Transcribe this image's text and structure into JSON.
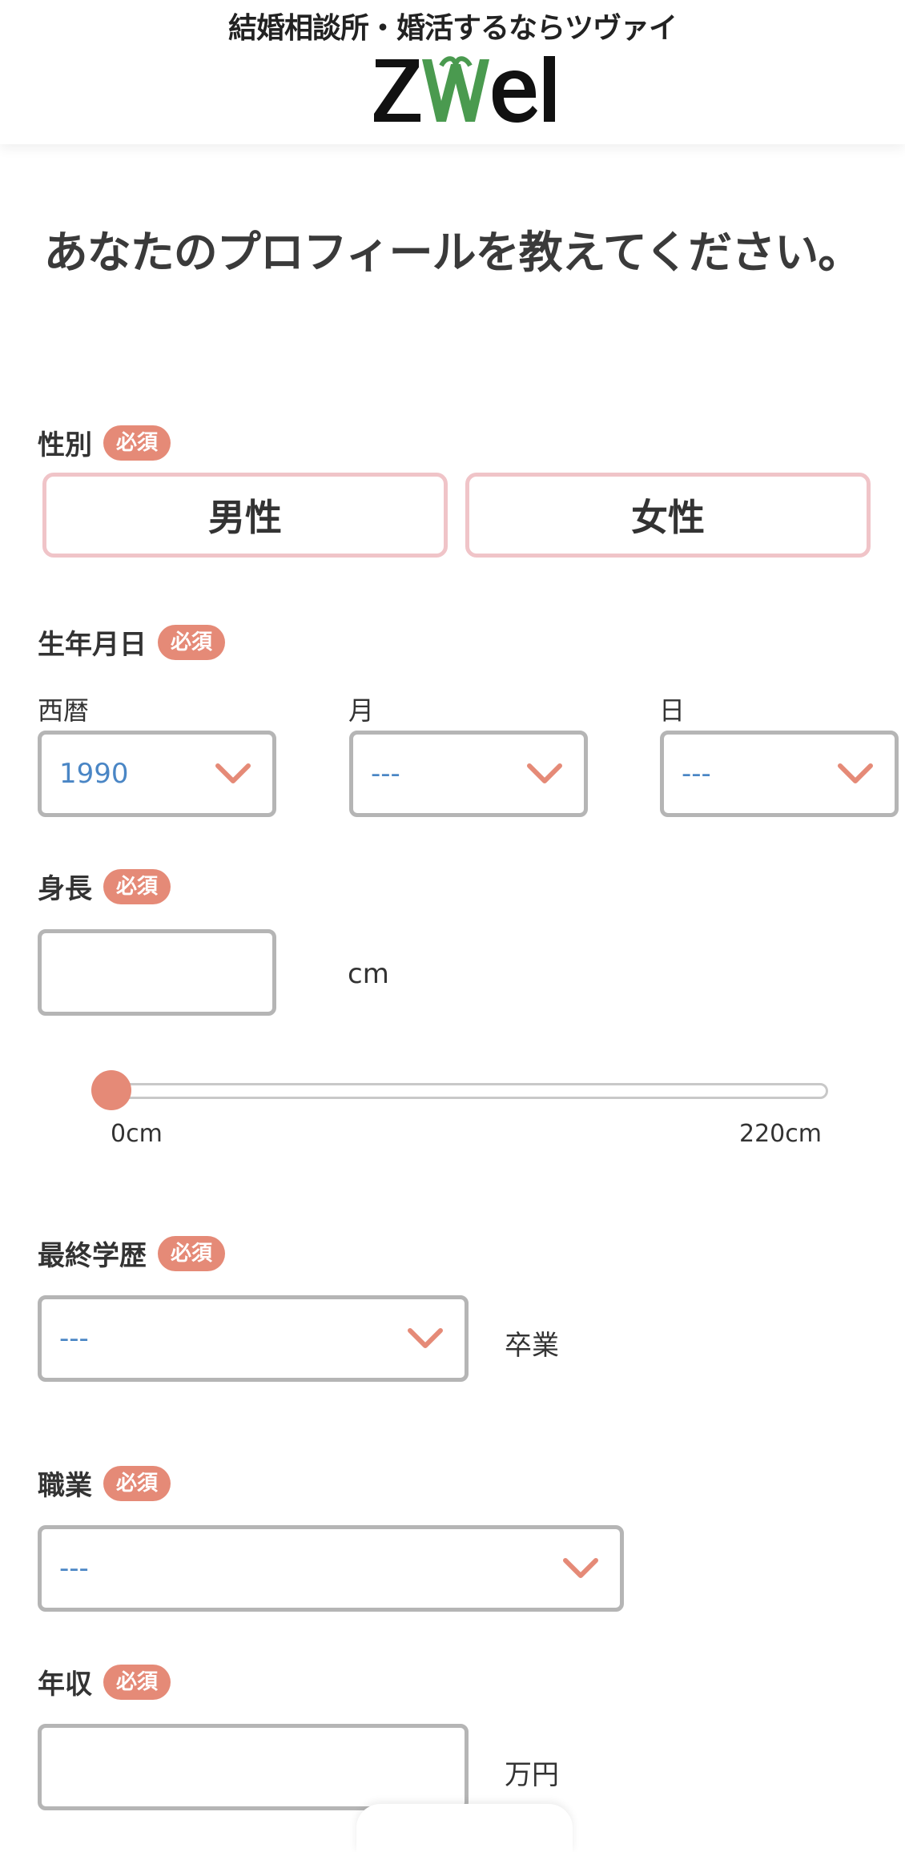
{
  "header": {
    "tagline": "結婚相談所・婚活するならツヴァイ",
    "logo_text": "ZWEI",
    "brand_color": "#4a9a4f"
  },
  "page_title": "あなたのプロフィールを教えてください。",
  "required_badge": "必須",
  "gender": {
    "label": "性別",
    "options": [
      "男性",
      "女性"
    ]
  },
  "birthdate": {
    "label": "生年月日",
    "year_label": "西暦",
    "year_value": "1990",
    "month_label": "月",
    "month_value": "---",
    "day_label": "日",
    "day_value": "---"
  },
  "height": {
    "label": "身長",
    "value": "",
    "unit": "cm",
    "slider_min_label": "0cm",
    "slider_max_label": "220cm",
    "slider_fraction": 0
  },
  "education": {
    "label": "最終学歴",
    "value": "---",
    "suffix": "卒業"
  },
  "occupation": {
    "label": "職業",
    "value": "---"
  },
  "income": {
    "label": "年収",
    "value": "",
    "unit": "万円"
  },
  "colors": {
    "accent": "#e58a77",
    "select_value": "#4a86c5",
    "gender_border": "#f0c4c8",
    "field_border": "#b5b5b5"
  }
}
